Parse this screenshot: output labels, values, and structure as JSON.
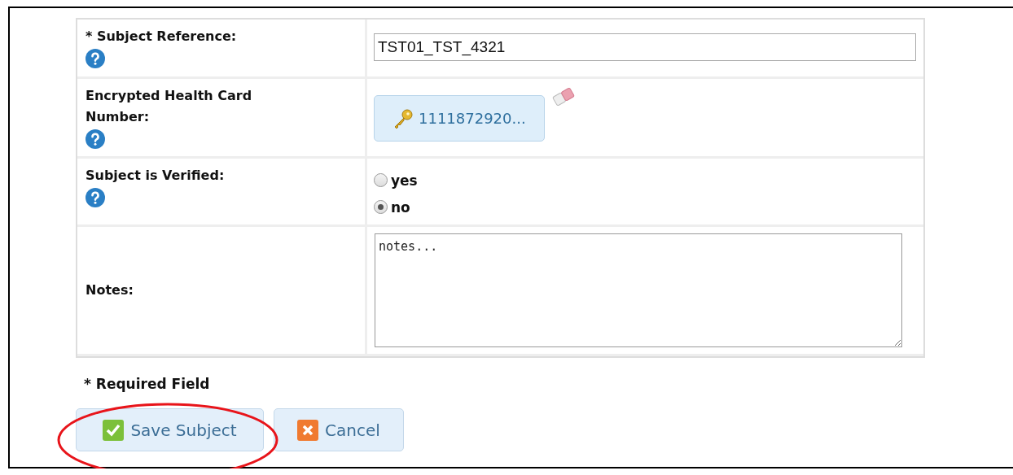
{
  "fields": [
    {
      "kind": "text",
      "label": "* Subject Reference:",
      "value": "TST01_TST_4321"
    },
    {
      "kind": "encrypted",
      "label": "Encrypted Health Card Number:",
      "value": "1111872920..."
    },
    {
      "kind": "radio",
      "label": "Subject is Verified:",
      "options": [
        {
          "label": "yes",
          "selected": false
        },
        {
          "label": "no",
          "selected": true
        }
      ]
    },
    {
      "kind": "textarea",
      "label": "Notes:",
      "value": "notes..."
    }
  ],
  "required_note": "* Required Field",
  "buttons": [
    {
      "kind": "save",
      "label": "Save Subject",
      "highlighted": true
    },
    {
      "kind": "cancel",
      "label": "Cancel",
      "highlighted": false
    }
  ]
}
